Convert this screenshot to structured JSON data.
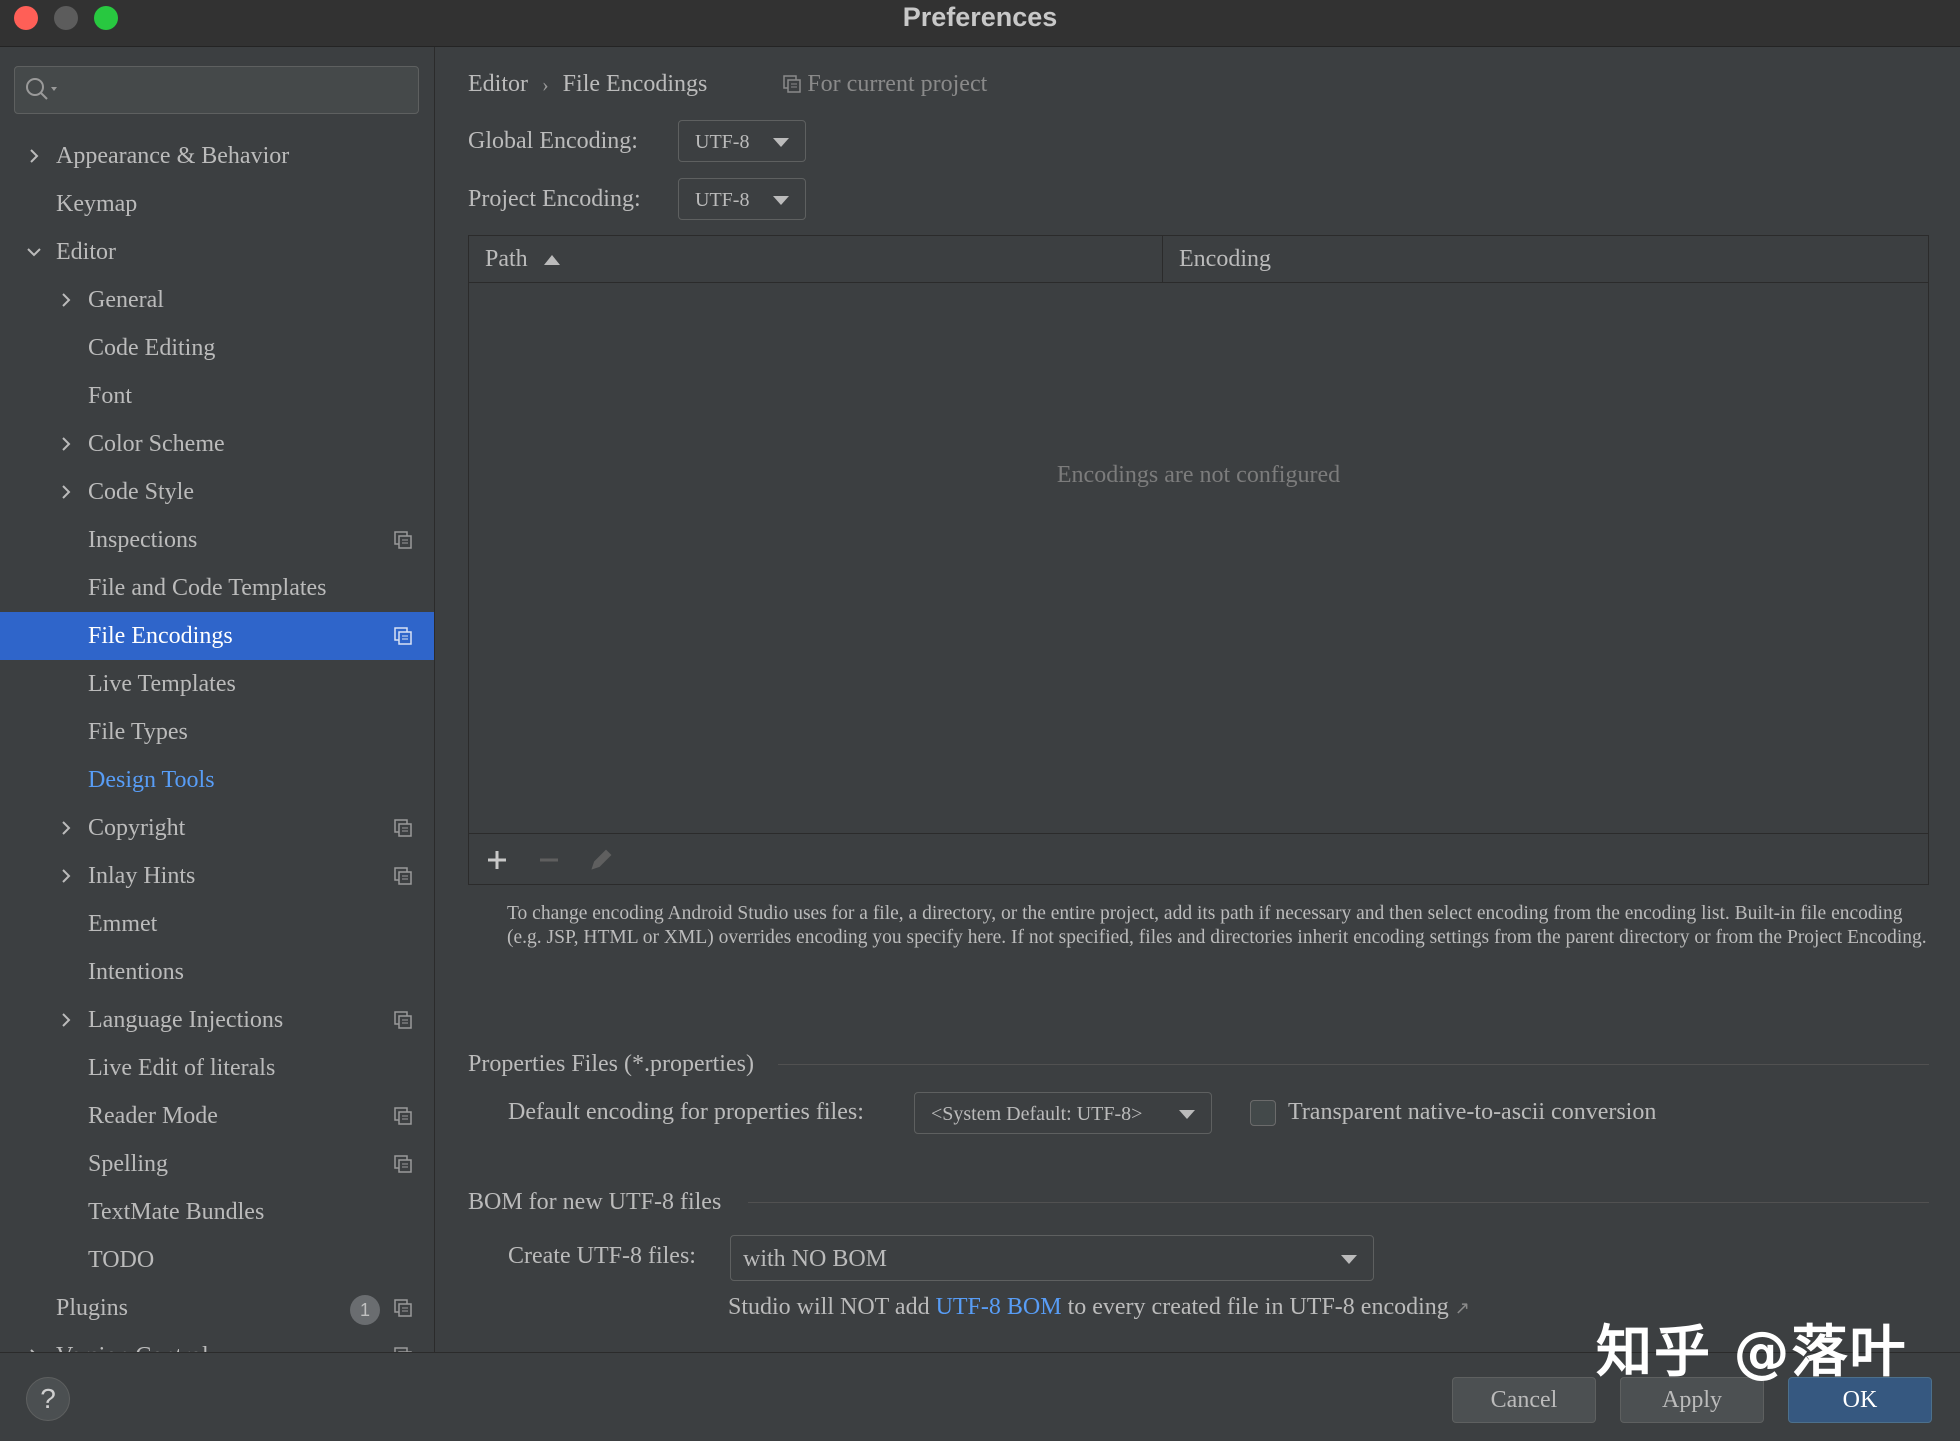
{
  "window": {
    "title": "Preferences"
  },
  "search": {
    "placeholder": ""
  },
  "sidebar": {
    "items": [
      {
        "label": "Appearance & Behavior"
      },
      {
        "label": "Keymap"
      },
      {
        "label": "Editor"
      },
      {
        "label": "General"
      },
      {
        "label": "Code Editing"
      },
      {
        "label": "Font"
      },
      {
        "label": "Color Scheme"
      },
      {
        "label": "Code Style"
      },
      {
        "label": "Inspections"
      },
      {
        "label": "File and Code Templates"
      },
      {
        "label": "File Encodings"
      },
      {
        "label": "Live Templates"
      },
      {
        "label": "File Types"
      },
      {
        "label": "Design Tools"
      },
      {
        "label": "Copyright"
      },
      {
        "label": "Inlay Hints"
      },
      {
        "label": "Emmet"
      },
      {
        "label": "Intentions"
      },
      {
        "label": "Language Injections"
      },
      {
        "label": "Live Edit of literals"
      },
      {
        "label": "Reader Mode"
      },
      {
        "label": "Spelling"
      },
      {
        "label": "TextMate Bundles"
      },
      {
        "label": "TODO"
      },
      {
        "label": "Plugins",
        "badge": "1"
      },
      {
        "label": "Version Control"
      }
    ]
  },
  "breadcrumb": {
    "parent": "Editor",
    "current": "File Encodings",
    "scope": "For current project"
  },
  "global_encoding": {
    "label": "Global Encoding:",
    "value": "UTF-8"
  },
  "project_encoding": {
    "label": "Project Encoding:",
    "value": "UTF-8"
  },
  "table": {
    "columns": [
      "Path",
      "Encoding"
    ],
    "empty_text": "Encodings are not configured"
  },
  "help_text": "To change encoding Android Studio uses for a file, a directory, or the entire project, add its path if necessary and then select encoding from the encoding list. Built-in file encoding (e.g. JSP, HTML or XML) overrides encoding you specify here. If not specified, files and directories inherit encoding settings from the parent directory or from the Project Encoding.",
  "properties": {
    "section_title": "Properties Files (*.properties)",
    "default_label": "Default encoding for properties files:",
    "default_value": "<System Default: UTF-8>",
    "transparent_label": "Transparent native-to-ascii conversion",
    "transparent_checked": false
  },
  "bom": {
    "section_title": "BOM for new UTF-8 files",
    "create_label": "Create UTF-8 files:",
    "create_value": "with NO BOM",
    "note_prefix": "Studio will NOT add",
    "note_link": "UTF-8 BOM",
    "note_suffix": "to every created file in UTF-8 encoding",
    "note_arrow": "↗"
  },
  "footer": {
    "help": "?",
    "cancel": "Cancel",
    "apply": "Apply",
    "ok": "OK"
  },
  "watermark": "知乎 @落叶",
  "colors": {
    "selection": "#2f65ca",
    "link": "#589df6",
    "ok_button": "#365880"
  }
}
